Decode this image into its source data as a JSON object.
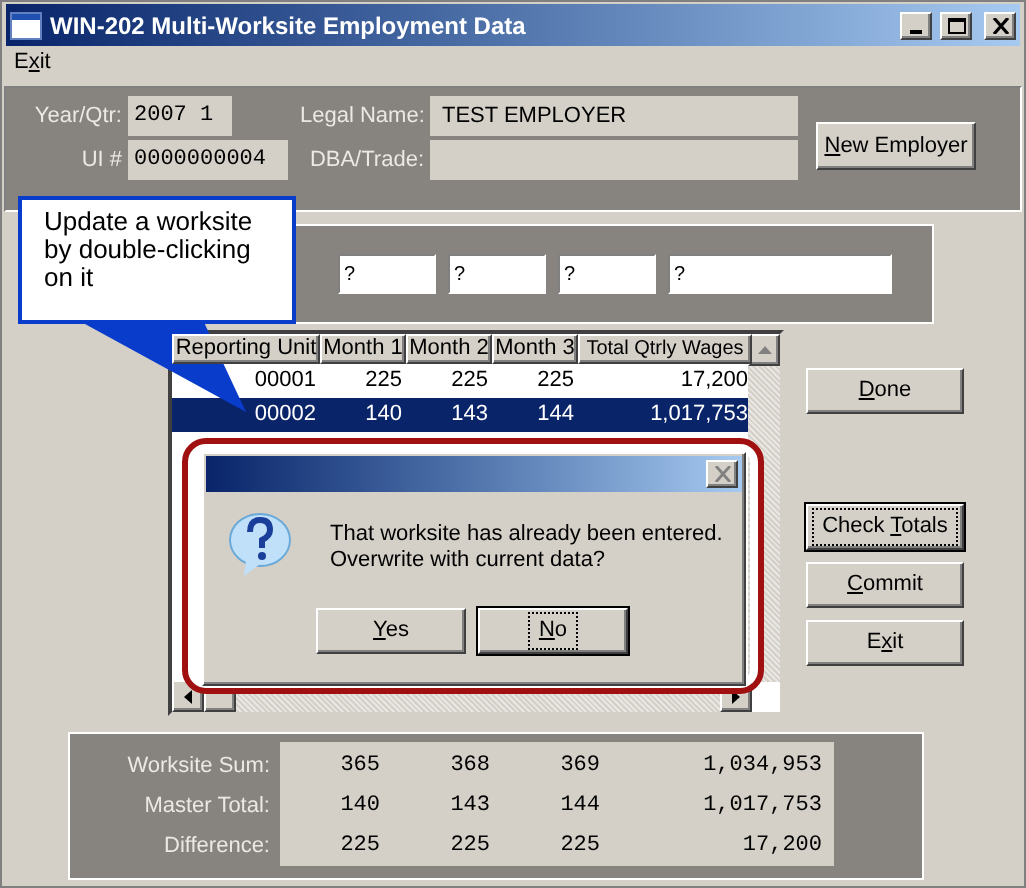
{
  "window": {
    "title": "WIN-202 Multi-Worksite Employment Data"
  },
  "menu": [
    {
      "before": "E",
      "key": "x",
      "after": "it"
    }
  ],
  "employer": {
    "year_qtr": {
      "label": "Year/Qtr:",
      "value": "2007 1"
    },
    "ui_number": {
      "label": "UI #",
      "value": "0000000004"
    },
    "legal_name": {
      "label": "Legal Name:",
      "value": "TEST EMPLOYER"
    },
    "dba_trade": {
      "label": "DBA/Trade:"
    },
    "new_employer_button": {
      "key": "N",
      "after": "ew Employer"
    }
  },
  "entry_fields": [
    "?",
    "?",
    "?",
    "?"
  ],
  "grid": {
    "columns": [
      "Reporting Unit",
      "Month 1",
      "Month 2",
      "Month 3",
      "Total Qtrly Wages"
    ],
    "rows": [
      {
        "cells": [
          "00001",
          "225",
          "225",
          "225",
          "17,200"
        ],
        "selected": false
      },
      {
        "cells": [
          "00002",
          "140",
          "143",
          "144",
          "1,017,753"
        ],
        "selected": true
      }
    ]
  },
  "buttons": [
    {
      "key": "D",
      "after": "one",
      "default": false
    },
    {
      "before": "Check ",
      "key": "T",
      "after": "otals",
      "default": true
    },
    {
      "key": "C",
      "after": "ommit",
      "default": false
    },
    {
      "before": "E",
      "key": "x",
      "after": "it",
      "default": false
    }
  ],
  "totals": [
    {
      "label": "Worksite Sum:",
      "values": [
        "365",
        "368",
        "369",
        "1,034,953"
      ]
    },
    {
      "label": "Master Total:",
      "values": [
        "140",
        "143",
        "144",
        "1,017,753"
      ]
    },
    {
      "label": "Difference:",
      "values": [
        "225",
        "225",
        "225",
        "17,200"
      ]
    }
  ],
  "callout": {
    "text": "Update a worksite by double-clicking on it"
  },
  "dialog": {
    "lines": [
      "That worksite has already been entered.",
      "Overwrite with current data?"
    ],
    "buttons": [
      {
        "key": "Y",
        "after": "es",
        "focused": false
      },
      {
        "key": "N",
        "after": "o",
        "focused": true
      }
    ]
  }
}
